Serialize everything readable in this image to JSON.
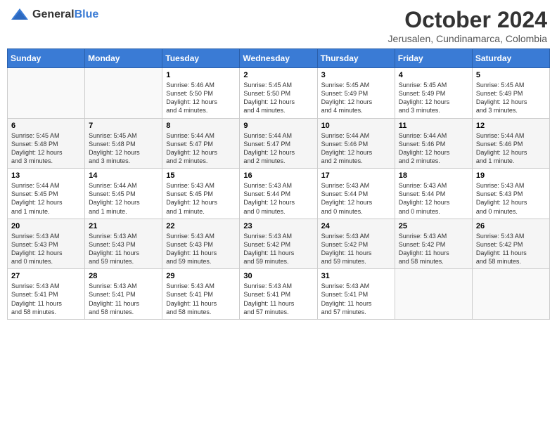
{
  "header": {
    "logo_general": "General",
    "logo_blue": "Blue",
    "month": "October 2024",
    "location": "Jerusalen, Cundinamarca, Colombia"
  },
  "weekdays": [
    "Sunday",
    "Monday",
    "Tuesday",
    "Wednesday",
    "Thursday",
    "Friday",
    "Saturday"
  ],
  "weeks": [
    [
      {
        "day": "",
        "detail": ""
      },
      {
        "day": "",
        "detail": ""
      },
      {
        "day": "1",
        "detail": "Sunrise: 5:46 AM\nSunset: 5:50 PM\nDaylight: 12 hours\nand 4 minutes."
      },
      {
        "day": "2",
        "detail": "Sunrise: 5:45 AM\nSunset: 5:50 PM\nDaylight: 12 hours\nand 4 minutes."
      },
      {
        "day": "3",
        "detail": "Sunrise: 5:45 AM\nSunset: 5:49 PM\nDaylight: 12 hours\nand 4 minutes."
      },
      {
        "day": "4",
        "detail": "Sunrise: 5:45 AM\nSunset: 5:49 PM\nDaylight: 12 hours\nand 3 minutes."
      },
      {
        "day": "5",
        "detail": "Sunrise: 5:45 AM\nSunset: 5:49 PM\nDaylight: 12 hours\nand 3 minutes."
      }
    ],
    [
      {
        "day": "6",
        "detail": "Sunrise: 5:45 AM\nSunset: 5:48 PM\nDaylight: 12 hours\nand 3 minutes."
      },
      {
        "day": "7",
        "detail": "Sunrise: 5:45 AM\nSunset: 5:48 PM\nDaylight: 12 hours\nand 3 minutes."
      },
      {
        "day": "8",
        "detail": "Sunrise: 5:44 AM\nSunset: 5:47 PM\nDaylight: 12 hours\nand 2 minutes."
      },
      {
        "day": "9",
        "detail": "Sunrise: 5:44 AM\nSunset: 5:47 PM\nDaylight: 12 hours\nand 2 minutes."
      },
      {
        "day": "10",
        "detail": "Sunrise: 5:44 AM\nSunset: 5:46 PM\nDaylight: 12 hours\nand 2 minutes."
      },
      {
        "day": "11",
        "detail": "Sunrise: 5:44 AM\nSunset: 5:46 PM\nDaylight: 12 hours\nand 2 minutes."
      },
      {
        "day": "12",
        "detail": "Sunrise: 5:44 AM\nSunset: 5:46 PM\nDaylight: 12 hours\nand 1 minute."
      }
    ],
    [
      {
        "day": "13",
        "detail": "Sunrise: 5:44 AM\nSunset: 5:45 PM\nDaylight: 12 hours\nand 1 minute."
      },
      {
        "day": "14",
        "detail": "Sunrise: 5:44 AM\nSunset: 5:45 PM\nDaylight: 12 hours\nand 1 minute."
      },
      {
        "day": "15",
        "detail": "Sunrise: 5:43 AM\nSunset: 5:45 PM\nDaylight: 12 hours\nand 1 minute."
      },
      {
        "day": "16",
        "detail": "Sunrise: 5:43 AM\nSunset: 5:44 PM\nDaylight: 12 hours\nand 0 minutes."
      },
      {
        "day": "17",
        "detail": "Sunrise: 5:43 AM\nSunset: 5:44 PM\nDaylight: 12 hours\nand 0 minutes."
      },
      {
        "day": "18",
        "detail": "Sunrise: 5:43 AM\nSunset: 5:44 PM\nDaylight: 12 hours\nand 0 minutes."
      },
      {
        "day": "19",
        "detail": "Sunrise: 5:43 AM\nSunset: 5:43 PM\nDaylight: 12 hours\nand 0 minutes."
      }
    ],
    [
      {
        "day": "20",
        "detail": "Sunrise: 5:43 AM\nSunset: 5:43 PM\nDaylight: 12 hours\nand 0 minutes."
      },
      {
        "day": "21",
        "detail": "Sunrise: 5:43 AM\nSunset: 5:43 PM\nDaylight: 11 hours\nand 59 minutes."
      },
      {
        "day": "22",
        "detail": "Sunrise: 5:43 AM\nSunset: 5:43 PM\nDaylight: 11 hours\nand 59 minutes."
      },
      {
        "day": "23",
        "detail": "Sunrise: 5:43 AM\nSunset: 5:42 PM\nDaylight: 11 hours\nand 59 minutes."
      },
      {
        "day": "24",
        "detail": "Sunrise: 5:43 AM\nSunset: 5:42 PM\nDaylight: 11 hours\nand 59 minutes."
      },
      {
        "day": "25",
        "detail": "Sunrise: 5:43 AM\nSunset: 5:42 PM\nDaylight: 11 hours\nand 58 minutes."
      },
      {
        "day": "26",
        "detail": "Sunrise: 5:43 AM\nSunset: 5:42 PM\nDaylight: 11 hours\nand 58 minutes."
      }
    ],
    [
      {
        "day": "27",
        "detail": "Sunrise: 5:43 AM\nSunset: 5:41 PM\nDaylight: 11 hours\nand 58 minutes."
      },
      {
        "day": "28",
        "detail": "Sunrise: 5:43 AM\nSunset: 5:41 PM\nDaylight: 11 hours\nand 58 minutes."
      },
      {
        "day": "29",
        "detail": "Sunrise: 5:43 AM\nSunset: 5:41 PM\nDaylight: 11 hours\nand 58 minutes."
      },
      {
        "day": "30",
        "detail": "Sunrise: 5:43 AM\nSunset: 5:41 PM\nDaylight: 11 hours\nand 57 minutes."
      },
      {
        "day": "31",
        "detail": "Sunrise: 5:43 AM\nSunset: 5:41 PM\nDaylight: 11 hours\nand 57 minutes."
      },
      {
        "day": "",
        "detail": ""
      },
      {
        "day": "",
        "detail": ""
      }
    ]
  ]
}
